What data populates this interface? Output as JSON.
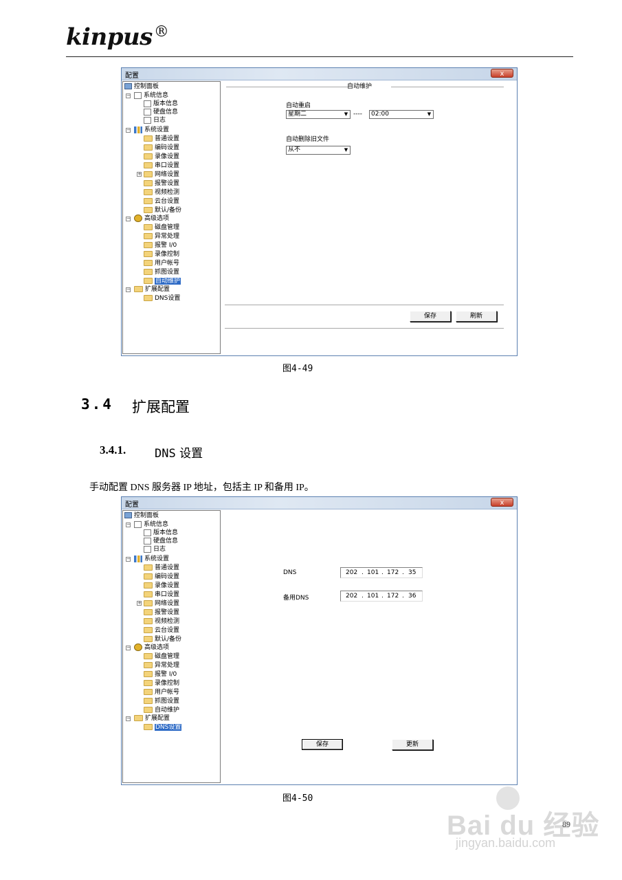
{
  "header": {
    "logo_text": "kinpus",
    "logo_mark": "®"
  },
  "figure1": {
    "window_title": "配置",
    "close_label": "x",
    "tree": {
      "root": "控制面板",
      "system_info": "系统信息",
      "version_info": "版本信息",
      "disk_info": "硬盘信息",
      "log": "日志",
      "system_settings": "系统设置",
      "general": "普通设置",
      "encode": "编码设置",
      "record": "录像设置",
      "serial": "串口设置",
      "network": "网络设置",
      "alarm": "报警设置",
      "video_detect": "视频检测",
      "ptz": "云台设置",
      "default_backup": "默认/备份",
      "advanced": "高级选项",
      "disk_mgmt": "磁盘管理",
      "exception": "异常处理",
      "alarm_io": "报警 I/0",
      "record_ctrl": "录像控制",
      "user_account": "用户帐号",
      "snapshot": "抓图设置",
      "auto_maint": "自动维护",
      "ext_config": "扩展配置",
      "dns": "DNS设置"
    },
    "panel_title": "自动维护",
    "auto_restart_label": "自动重启",
    "restart_day": "星期二",
    "separator": "----",
    "restart_time": "02:00",
    "auto_delete_label": "自动删除旧文件",
    "delete_value": "从不",
    "save_label": "保存",
    "refresh_label": "刷新"
  },
  "caption1": "图4-49",
  "section": {
    "number": "3.4",
    "title": "扩展配置"
  },
  "subsection": {
    "number": "3.4.1.",
    "title_en": "DNS",
    "title_cn": "设置"
  },
  "paragraph": "手动配置 DNS 服务器 IP 地址，包括主 IP 和备用 IP。",
  "figure2": {
    "window_title": "配置",
    "close_label": "x",
    "dns_label": "DNS",
    "dns_ip": [
      "202",
      "101",
      "172",
      "35"
    ],
    "alt_dns_label": "备用DNS",
    "alt_dns_ip": [
      "202",
      "101",
      "172",
      "36"
    ],
    "ip_dot": ".",
    "save_label": "保存",
    "update_label": "更新"
  },
  "caption2": "图4-50",
  "watermark": {
    "brand": "Bai du 经验",
    "site": "jingyan.baidu.com"
  },
  "page_number": "89"
}
